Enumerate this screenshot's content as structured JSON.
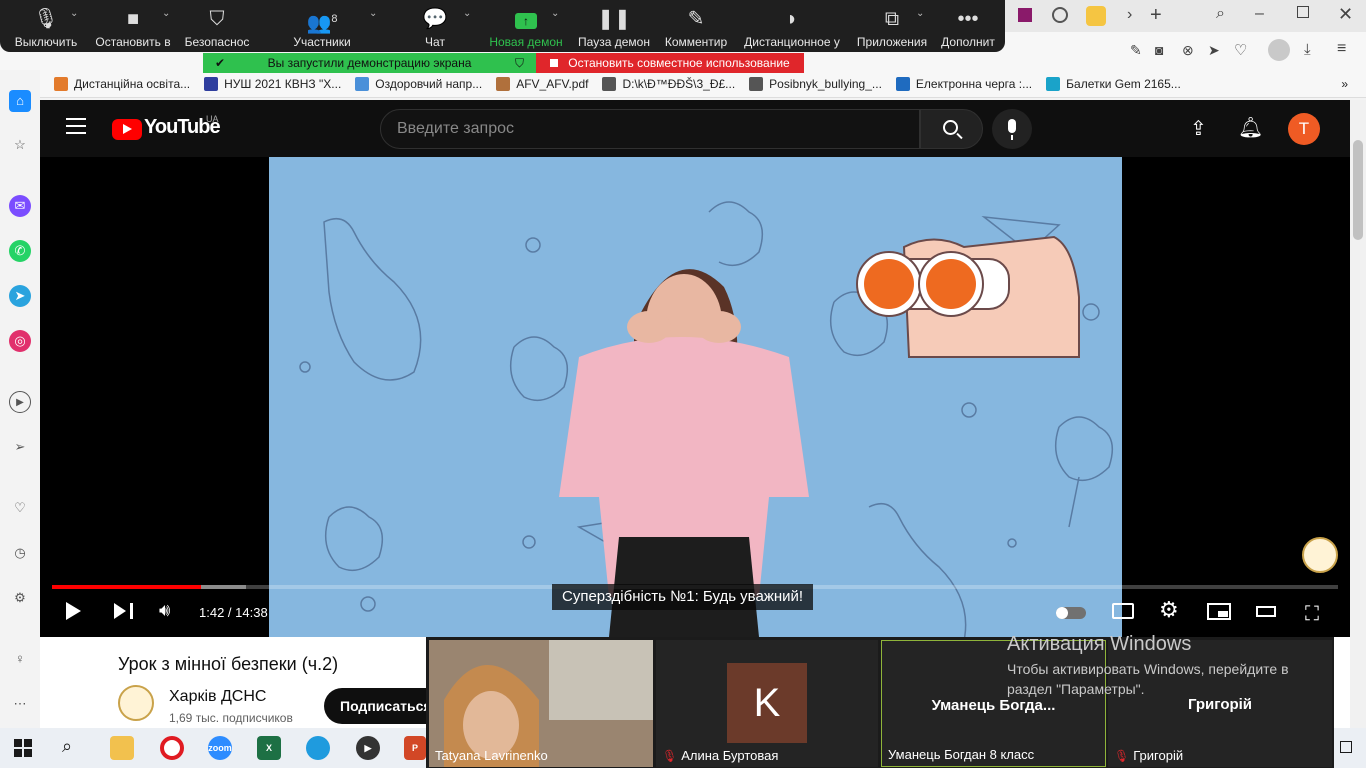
{
  "zoom_toolbar": {
    "items": [
      {
        "label": "Выключить",
        "icon": "microphone-icon"
      },
      {
        "label": "Остановить в",
        "icon": "video-camera-icon"
      },
      {
        "label": "Безопаснос",
        "icon": "shield-icon"
      },
      {
        "label": "Участники",
        "icon": "participants-icon",
        "count": "8"
      },
      {
        "label": "Чат",
        "icon": "chat-icon"
      },
      {
        "label": "Новая демон",
        "icon": "share-screen-icon"
      },
      {
        "label": "Пауза демон",
        "icon": "pause-icon"
      },
      {
        "label": "Комментир",
        "icon": "annotate-pen-icon"
      },
      {
        "label": "Дистанционное у",
        "icon": "remote-control-icon"
      },
      {
        "label": "Приложения",
        "icon": "apps-icon"
      },
      {
        "label": "Дополнит",
        "icon": "more-icon"
      }
    ],
    "share_banner": "Вы запустили демонстрацию экрана",
    "stop_banner": "Остановить совместное использование",
    "accent_green": "#2fc14e",
    "accent_red": "#e0262b"
  },
  "bookmarks": [
    {
      "label": "Дистанційна освіта...",
      "color": "#e37b2c"
    },
    {
      "label": "НУШ 2021 КВНЗ \"Х...",
      "color": "#2f3e9e"
    },
    {
      "label": "Оздоровчий напр...",
      "color": "#4a90d9"
    },
    {
      "label": "AFV_AFV.pdf",
      "color": "#b0703c"
    },
    {
      "label": "D:\\k\\Ð™ÐÐŠ\\3_Ð£...",
      "color": "#555555"
    },
    {
      "label": "Posibnyk_bullying_...",
      "color": "#555555"
    },
    {
      "label": "Електронна черга :...",
      "color": "#1f6bbf"
    },
    {
      "label": "Балетки Gem 2165...",
      "color": "#1aa3c9"
    }
  ],
  "youtube": {
    "logo_text": "YouTube",
    "region": "UA",
    "search_placeholder": "Введите запрос",
    "avatar_letter": "T",
    "avatar_color": "#ef5b24"
  },
  "player": {
    "caption": "Суперздібність №1: Будь уважний!",
    "time": "1:42 / 14:38",
    "progress_played": 0.116,
    "progress_buffered": 0.151
  },
  "video_info": {
    "title": "Урок з мінної безпеки (ч.2)",
    "channel": "Харків ДСНС",
    "subscribers": "1,69 тыс. подписчиков",
    "subscribe_label": "Подписаться"
  },
  "participants": [
    {
      "name": "Tatyana Lavrinenko",
      "muted": false,
      "video": true
    },
    {
      "name": "Алина Буртовая",
      "muted": true,
      "initial": "K"
    },
    {
      "name": "Уманець Богдан 8 класс",
      "center": "Уманець  Богда...",
      "muted": false,
      "active": true
    },
    {
      "name": "Григорій",
      "center": "Григорій",
      "muted": true
    }
  ],
  "windows_activation": {
    "title": "Активация Windows",
    "text": "Чтобы активировать Windows, перейдите в раздел \"Параметры\"."
  }
}
